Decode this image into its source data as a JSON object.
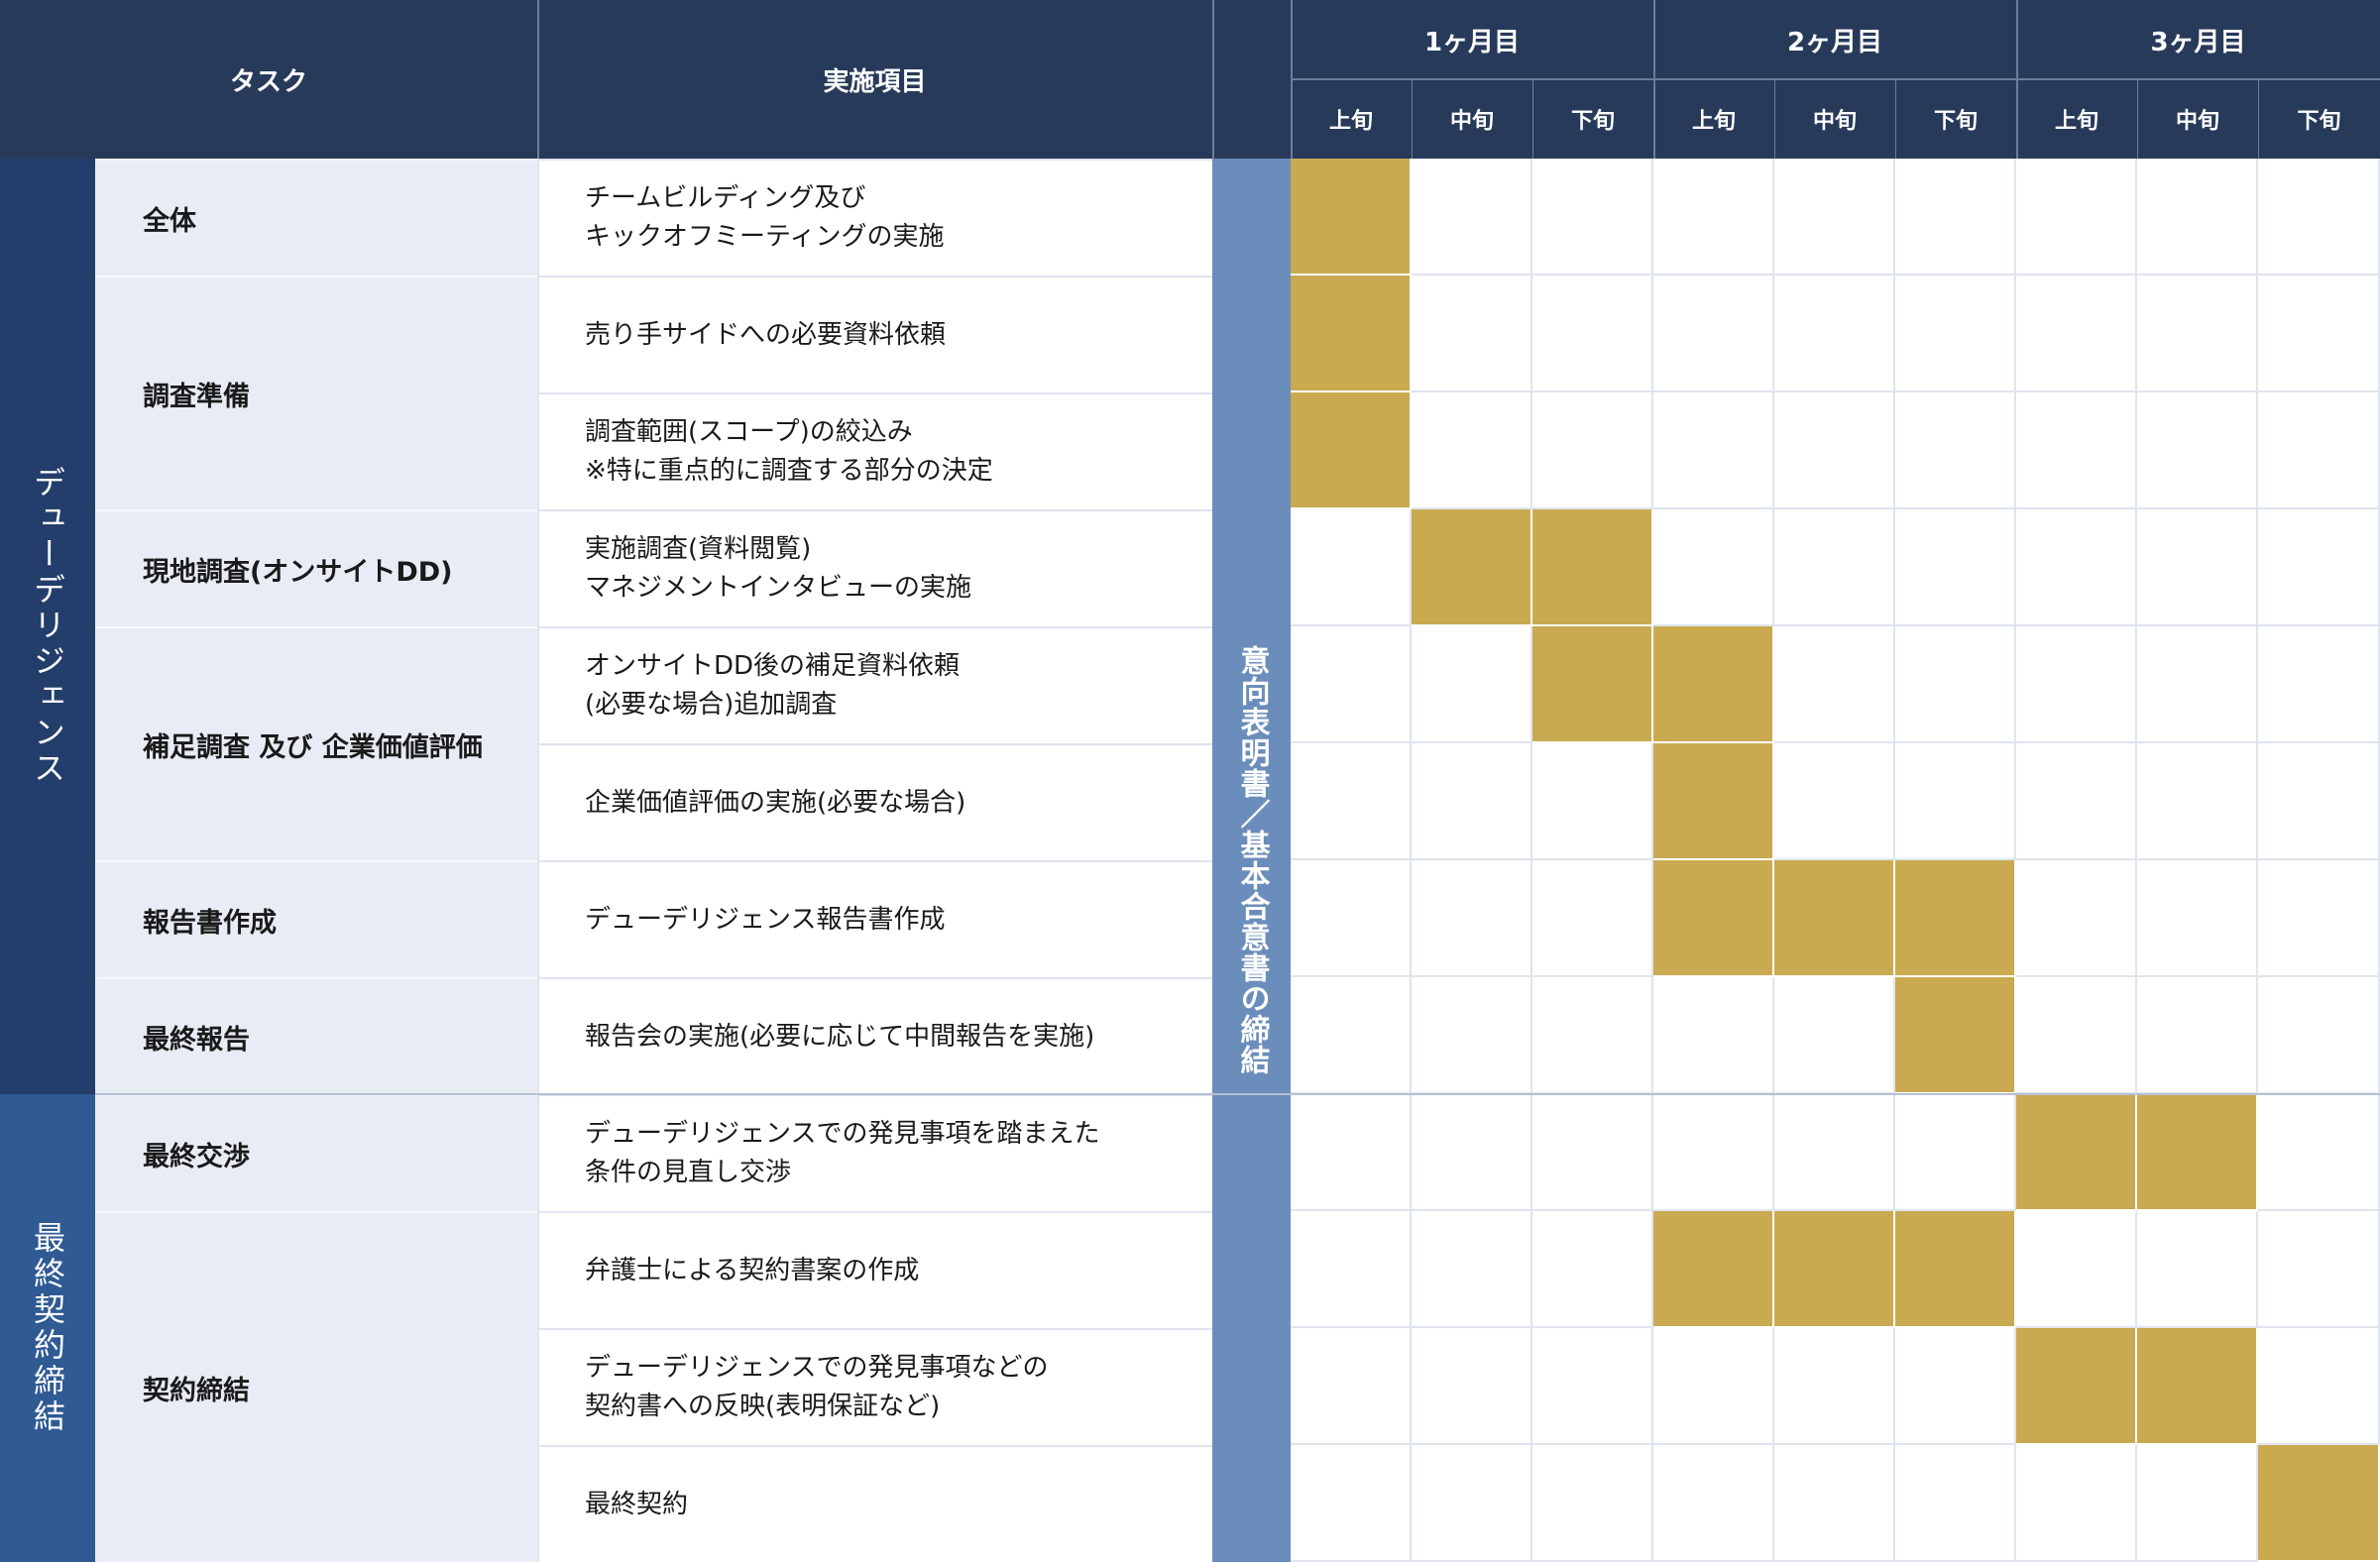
{
  "header": {
    "task_label": "タスク",
    "item_label": "実施項目",
    "months": [
      "1ヶ月目",
      "2ヶ月目",
      "3ヶ月目"
    ],
    "periods": [
      "上旬",
      "中旬",
      "下旬",
      "上旬",
      "中旬",
      "下旬",
      "上旬",
      "中旬",
      "下旬"
    ]
  },
  "groups": [
    {
      "label": "デューデリジェンス",
      "color": "#233e6b"
    },
    {
      "label": "最終契約締結",
      "color": "#2f5a93"
    }
  ],
  "tasks": [
    {
      "label": "全体"
    },
    {
      "label": "調査準備"
    },
    {
      "label": "現地調査(オンサイトDD)"
    },
    {
      "label": "補足調査 及び 企業価値評価"
    },
    {
      "label": "報告書作成"
    },
    {
      "label": "最終報告"
    },
    {
      "label": "最終交渉"
    },
    {
      "label": "契約締結"
    }
  ],
  "items": [
    {
      "text": "チームビルディング及び\nキックオフミーティングの実施",
      "active": [
        1,
        0,
        0,
        0,
        0,
        0,
        0,
        0,
        0
      ]
    },
    {
      "text": "売り手サイドへの必要資料依頼",
      "active": [
        1,
        0,
        0,
        0,
        0,
        0,
        0,
        0,
        0
      ]
    },
    {
      "text": "調査範囲(スコープ)の絞込み\n※特に重点的に調査する部分の決定",
      "active": [
        1,
        0,
        0,
        0,
        0,
        0,
        0,
        0,
        0
      ]
    },
    {
      "text": "実施調査(資料閲覧)\nマネジメントインタビューの実施",
      "active": [
        0,
        1,
        1,
        0,
        0,
        0,
        0,
        0,
        0
      ]
    },
    {
      "text": "オンサイトDD後の補足資料依頼\n(必要な場合)追加調査",
      "active": [
        0,
        0,
        1,
        1,
        0,
        0,
        0,
        0,
        0
      ]
    },
    {
      "text": "企業価値評価の実施(必要な場合)",
      "active": [
        0,
        0,
        0,
        1,
        0,
        0,
        0,
        0,
        0
      ]
    },
    {
      "text": "デューデリジェンス報告書作成",
      "active": [
        0,
        0,
        0,
        1,
        1,
        1,
        0,
        0,
        0
      ]
    },
    {
      "text": "報告会の実施(必要に応じて中間報告を実施)",
      "active": [
        0,
        0,
        0,
        0,
        0,
        1,
        0,
        0,
        0
      ]
    },
    {
      "text": "デューデリジェンスでの発見事項を踏まえた\n条件の見直し交渉",
      "active": [
        0,
        0,
        0,
        0,
        0,
        0,
        1,
        1,
        0
      ]
    },
    {
      "text": "弁護士による契約書案の作成",
      "active": [
        0,
        0,
        0,
        1,
        1,
        1,
        0,
        0,
        0
      ]
    },
    {
      "text": "デューデリジェンスでの発見事項などの\n契約書への反映(表明保証など)",
      "active": [
        0,
        0,
        0,
        0,
        0,
        0,
        1,
        1,
        0
      ]
    },
    {
      "text": "最終契約",
      "active": [
        0,
        0,
        0,
        0,
        0,
        0,
        0,
        0,
        1
      ]
    }
  ],
  "milestone": {
    "label": "意向表明書／基本合意書の締結"
  },
  "colors": {
    "header_bg": "#283a5a",
    "task_bg": "#e8ecf4",
    "milestone_bg": "#6b8dbb",
    "bar": "#c9aa51"
  }
}
